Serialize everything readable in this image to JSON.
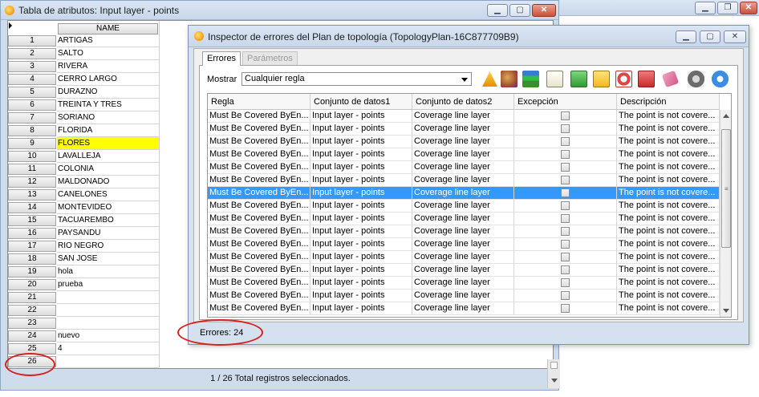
{
  "attr_window": {
    "title": "Tabla de atributos: Input layer - points",
    "column_header": "NAME",
    "rows": [
      {
        "n": "1",
        "name": "ARTIGAS"
      },
      {
        "n": "2",
        "name": "SALTO"
      },
      {
        "n": "3",
        "name": "RIVERA"
      },
      {
        "n": "4",
        "name": "CERRO LARGO"
      },
      {
        "n": "5",
        "name": "DURAZNO"
      },
      {
        "n": "6",
        "name": "TREINTA Y TRES"
      },
      {
        "n": "7",
        "name": "SORIANO"
      },
      {
        "n": "8",
        "name": "FLORIDA"
      },
      {
        "n": "9",
        "name": "FLORES"
      },
      {
        "n": "10",
        "name": "LAVALLEJA"
      },
      {
        "n": "11",
        "name": "COLONIA"
      },
      {
        "n": "12",
        "name": "MALDONADO"
      },
      {
        "n": "13",
        "name": "CANELONES"
      },
      {
        "n": "14",
        "name": "MONTEVIDEO"
      },
      {
        "n": "15",
        "name": "TACUAREMBO"
      },
      {
        "n": "16",
        "name": "PAYSANDU"
      },
      {
        "n": "17",
        "name": "RIO NEGRO"
      },
      {
        "n": "18",
        "name": "SAN JOSE"
      },
      {
        "n": "19",
        "name": "hola"
      },
      {
        "n": "20",
        "name": "prueba"
      },
      {
        "n": "21",
        "name": ""
      },
      {
        "n": "22",
        "name": ""
      },
      {
        "n": "23",
        "name": ""
      },
      {
        "n": "24",
        "name": "nuevo"
      },
      {
        "n": "25",
        "name": "4"
      },
      {
        "n": "26",
        "name": ""
      }
    ],
    "highlight_row": "9",
    "highlight_color": "#ffff00",
    "status": "1 / 26 Total registros seleccionados."
  },
  "inspector": {
    "title": "Inspector de errores del Plan de topología (TopologyPlan-16C877709B9)",
    "tabs": [
      "Errores",
      "Parámetros"
    ],
    "show_label": "Mostrar",
    "show_value": "Cualquier regla",
    "toolbar_icons": [
      "warning-icon",
      "error-marker-icon",
      "layers-icon",
      "report-icon",
      "zoom-to-error-icon",
      "select-error-icon",
      "pan-to-error-icon",
      "fix-error-icon",
      "eraser-icon",
      "settings-gear-icon",
      "refresh-icon"
    ],
    "columns": [
      "Regla",
      "Conjunto de datos1",
      "Conjunto de datos2",
      "Excepción",
      "Descripción"
    ],
    "rows": [
      {
        "rule": "Must Be Covered ByEn...",
        "ds1": "Input layer - points",
        "ds2": "Coverage line layer",
        "desc": "The point is not covere..."
      },
      {
        "rule": "Must Be Covered ByEn...",
        "ds1": "Input layer - points",
        "ds2": "Coverage line layer",
        "desc": "The point is not covere..."
      },
      {
        "rule": "Must Be Covered ByEn...",
        "ds1": "Input layer - points",
        "ds2": "Coverage line layer",
        "desc": "The point is not covere..."
      },
      {
        "rule": "Must Be Covered ByEn...",
        "ds1": "Input layer - points",
        "ds2": "Coverage line layer",
        "desc": "The point is not covere..."
      },
      {
        "rule": "Must Be Covered ByEn...",
        "ds1": "Input layer - points",
        "ds2": "Coverage line layer",
        "desc": "The point is not covere..."
      },
      {
        "rule": "Must Be Covered ByEn...",
        "ds1": "Input layer - points",
        "ds2": "Coverage line layer",
        "desc": "The point is not covere..."
      },
      {
        "rule": "Must Be Covered ByEn...",
        "ds1": "Input layer - points",
        "ds2": "Coverage line layer",
        "desc": "The point is not covere..."
      },
      {
        "rule": "Must Be Covered ByEn...",
        "ds1": "Input layer - points",
        "ds2": "Coverage line layer",
        "desc": "The point is not covere..."
      },
      {
        "rule": "Must Be Covered ByEn...",
        "ds1": "Input layer - points",
        "ds2": "Coverage line layer",
        "desc": "The point is not covere..."
      },
      {
        "rule": "Must Be Covered ByEn...",
        "ds1": "Input layer - points",
        "ds2": "Coverage line layer",
        "desc": "The point is not covere..."
      },
      {
        "rule": "Must Be Covered ByEn...",
        "ds1": "Input layer - points",
        "ds2": "Coverage line layer",
        "desc": "The point is not covere..."
      },
      {
        "rule": "Must Be Covered ByEn...",
        "ds1": "Input layer - points",
        "ds2": "Coverage line layer",
        "desc": "The point is not covere..."
      },
      {
        "rule": "Must Be Covered ByEn...",
        "ds1": "Input layer - points",
        "ds2": "Coverage line layer",
        "desc": "The point is not covere..."
      },
      {
        "rule": "Must Be Covered ByEn...",
        "ds1": "Input layer - points",
        "ds2": "Coverage line layer",
        "desc": "The point is not covere..."
      },
      {
        "rule": "Must Be Covered ByEn...",
        "ds1": "Input layer - points",
        "ds2": "Coverage line layer",
        "desc": "The point is not covere..."
      },
      {
        "rule": "Must Be Covered ByEn...",
        "ds1": "Input layer - points",
        "ds2": "Coverage line layer",
        "desc": "The point is not covere..."
      }
    ],
    "selected_row_index": 6,
    "selection_color": "#3399ff",
    "errors_label": "Errores: 24"
  },
  "annotation_color": "#d9201c"
}
